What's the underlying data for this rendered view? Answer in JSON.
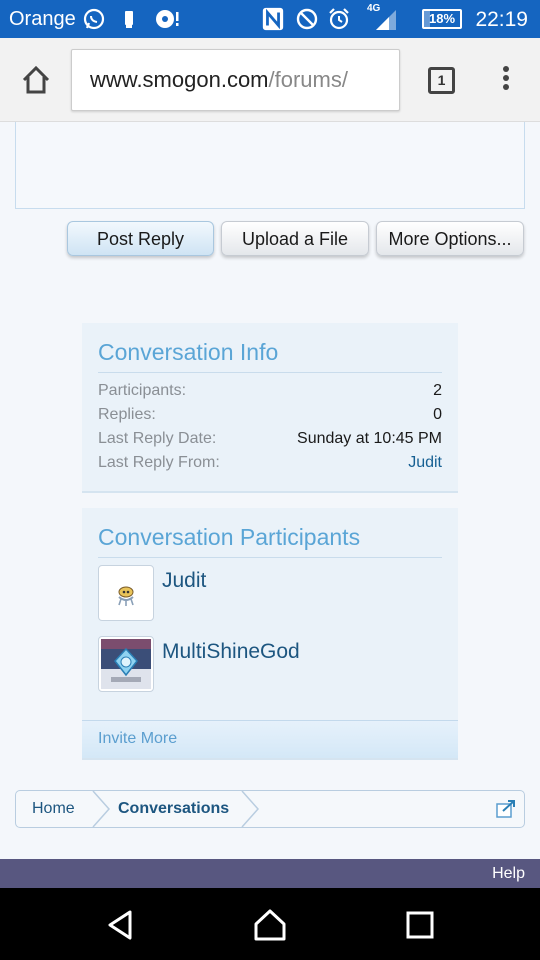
{
  "status": {
    "carrier": "Orange",
    "battery": "18%",
    "battery_level": 0.18,
    "time": "22:19",
    "network": "4G"
  },
  "browser": {
    "url_host": "www.smogon.com",
    "url_path": "/forums/",
    "tab_count": "1"
  },
  "actions": {
    "post_reply": "Post Reply",
    "upload": "Upload a File",
    "more": "More Options..."
  },
  "info": {
    "title": "Conversation Info",
    "rows": [
      {
        "label": "Participants:",
        "value": "2"
      },
      {
        "label": "Replies:",
        "value": "0"
      },
      {
        "label": "Last Reply Date:",
        "value": "Sunday at 10:45 PM"
      },
      {
        "label": "Last Reply From:",
        "value": "Judit"
      }
    ]
  },
  "participants": {
    "title": "Conversation Participants",
    "list": [
      {
        "name": "Judit"
      },
      {
        "name": "MultiShineGod"
      }
    ],
    "invite": "Invite More"
  },
  "breadcrumb": {
    "items": [
      "Home",
      "Conversations"
    ]
  },
  "footer": {
    "help": "Help"
  },
  "colors": {
    "status_bar": "#1565c0",
    "link": "#176093",
    "panel_title": "#5aa5d6",
    "footer": "#585780"
  }
}
